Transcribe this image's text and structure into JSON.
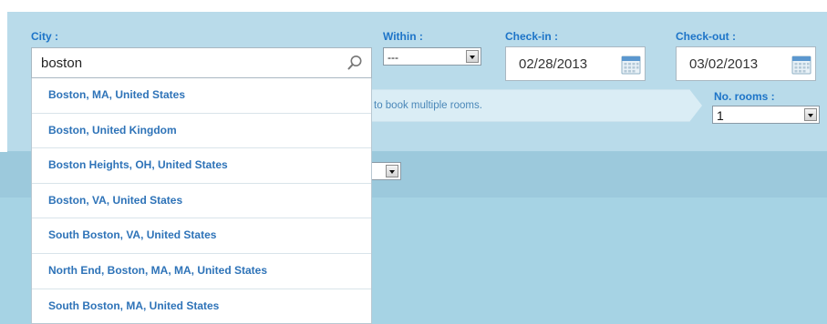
{
  "search_form": {
    "city": {
      "label": "City :",
      "value": "boston"
    },
    "within": {
      "label": "Within :",
      "value": "---"
    },
    "check_in": {
      "label": "Check-in :",
      "value": "02/28/2013"
    },
    "check_out": {
      "label": "Check-out :",
      "value": "03/02/2013"
    },
    "info_banner": "to book multiple rooms.",
    "rooms": {
      "label": "No. rooms :",
      "value": "1"
    },
    "hidden_select_value": ""
  },
  "autocomplete": {
    "items": [
      {
        "label": "Boston, MA, United States"
      },
      {
        "label": "Boston, United Kingdom"
      },
      {
        "label": "Boston Heights, OH, United States"
      },
      {
        "label": "Boston, VA, United States"
      },
      {
        "label": "South Boston, VA, United States"
      },
      {
        "label": "North End, Boston, MA, MA, United States"
      },
      {
        "label": "South Boston, MA, United States"
      }
    ]
  },
  "icons": {
    "search": "search-icon",
    "calendar": "calendar-icon",
    "dropdown": "chevron-down-icon"
  },
  "colors": {
    "panel_bg": "#b9dbea",
    "label_blue": "#1d74c8",
    "link_blue": "#2e73b8",
    "banner_bg": "#daedf5",
    "lower_bg": "#a6d3e4"
  }
}
